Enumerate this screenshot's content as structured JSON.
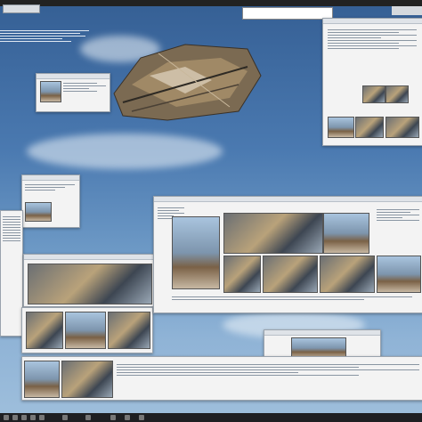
{
  "topbar": {
    "search_placeholder": ""
  },
  "taskbar": {
    "items": [
      "",
      "",
      "",
      "",
      "",
      "",
      "",
      "",
      "",
      ""
    ]
  },
  "windows": [
    {
      "id": "main-browser"
    },
    {
      "id": "right-browser"
    },
    {
      "id": "left-panel"
    },
    {
      "id": "bottom-strip"
    }
  ],
  "colors": {
    "sky_top": "#355f94",
    "sky_bottom": "#9fbfdc",
    "taskbar": "#1e1f22",
    "window_bg": "#f3f3f3"
  }
}
